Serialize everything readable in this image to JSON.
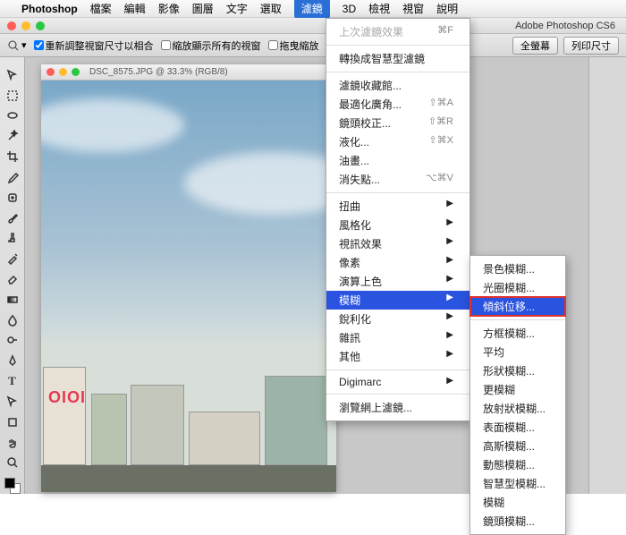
{
  "menubar": {
    "apple": "",
    "app": "Photoshop",
    "items": [
      "檔案",
      "編輯",
      "影像",
      "圖層",
      "文字",
      "選取",
      "濾鏡",
      "3D",
      "檢視",
      "視窗",
      "說明"
    ],
    "highlight_index": 6
  },
  "window": {
    "title": "Adobe Photoshop CS6"
  },
  "options": {
    "chk1": "重新調整視窗尺寸以相合",
    "chk2": "縮放顯示所有的視窗",
    "chk3": "拖曳縮放",
    "btn1": "全螢幕",
    "btn2": "列印尺寸"
  },
  "doc": {
    "title": "DSC_8575.JPG @ 33.3% (RGB/8)",
    "sign": "OIOI"
  },
  "menu_filter": {
    "recent": "上次濾鏡效果",
    "recent_sc": "⌘F",
    "smart": "轉換成智慧型濾鏡",
    "gallery": "濾鏡收藏館...",
    "wide": "最適化廣角...",
    "wide_sc": "⇧⌘A",
    "lens": "鏡頭校正...",
    "lens_sc": "⇧⌘R",
    "liquify": "液化...",
    "liquify_sc": "⇧⌘X",
    "oil": "油畫...",
    "vanish": "消失點...",
    "vanish_sc": "⌥⌘V",
    "distort": "扭曲",
    "stylize": "風格化",
    "video": "視訊效果",
    "pixelate": "像素",
    "render": "演算上色",
    "blur": "模糊",
    "sharpen": "銳利化",
    "noise": "雜訊",
    "other": "其他",
    "digimarc": "Digimarc",
    "browse": "瀏覽網上濾鏡..."
  },
  "menu_blur": {
    "field": "景色模糊...",
    "iris": "光圈模糊...",
    "tilt": "傾斜位移...",
    "box": "方框模糊...",
    "average": "平均",
    "shape": "形狀模糊...",
    "more": "更模糊",
    "radial": "放射狀模糊...",
    "surface": "表面模糊...",
    "gaussian": "高斯模糊...",
    "motion": "動態模糊...",
    "smart": "智慧型模糊...",
    "blur": "模糊",
    "lens": "鏡頭模糊..."
  }
}
